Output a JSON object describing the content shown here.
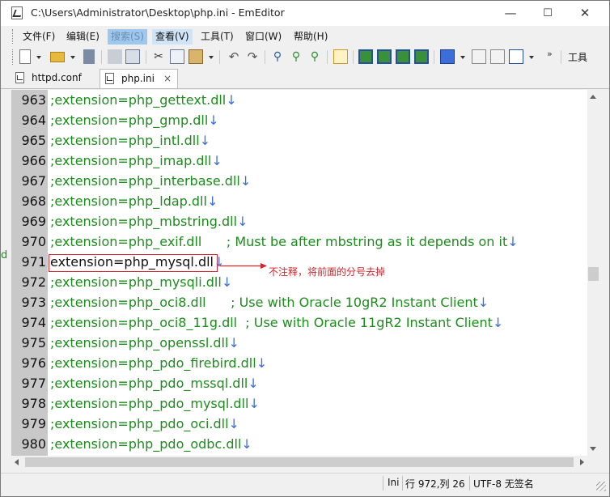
{
  "window": {
    "title": "C:\\Users\\Administrator\\Desktop\\php.ini - EmEditor",
    "controls": {
      "minimize": "—",
      "maximize": "☐",
      "close": "✕"
    }
  },
  "menu": [
    {
      "label": "文件(F)"
    },
    {
      "label": "编辑(E)"
    },
    {
      "label": "搜索(S)"
    },
    {
      "label": "查看(V)"
    },
    {
      "label": "工具(T)"
    },
    {
      "label": "窗口(W)"
    },
    {
      "label": "帮助(H)"
    }
  ],
  "toolbar": {
    "overflow": "»",
    "tools_label": "工具",
    "icons": [
      "new-file-icon",
      "open-folder-icon",
      "save-icon",
      "print-icon",
      "print-preview-icon",
      "cut-icon",
      "copy-icon",
      "paste-icon",
      "undo-icon",
      "redo-icon",
      "find-icon",
      "find-next-icon",
      "find-previous-icon",
      "highlight-icon",
      "toolbar-green-icon",
      "toolbar-refresh-icon",
      "toolbar-sync-icon",
      "toolbar-export-icon",
      "macro-icon",
      "record-macro-icon",
      "run-macro-icon",
      "window-icon"
    ]
  },
  "tabs": [
    {
      "label": "httpd.conf",
      "active": false
    },
    {
      "label": "php.ini",
      "active": true,
      "close": "×"
    }
  ],
  "editor": {
    "current_line": 971,
    "lines": [
      {
        "num": "963",
        "text": ";extension=php_gettext.dll"
      },
      {
        "num": "964",
        "text": ";extension=php_gmp.dll"
      },
      {
        "num": "965",
        "text": ";extension=php_intl.dll"
      },
      {
        "num": "966",
        "text": ";extension=php_imap.dll"
      },
      {
        "num": "967",
        "text": ";extension=php_interbase.dll"
      },
      {
        "num": "968",
        "text": ";extension=php_ldap.dll"
      },
      {
        "num": "969",
        "text": ";extension=php_mbstring.dll"
      },
      {
        "num": "970",
        "text": ";extension=php_exif.dll      ; Must be after mbstring as it depends on it"
      },
      {
        "num": "971",
        "text": "extension=php_mysql.dll"
      },
      {
        "num": "972",
        "text": ";extension=php_mysqli.dll"
      },
      {
        "num": "973",
        "text": ";extension=php_oci8.dll      ; Use with Oracle 10gR2 Instant Client"
      },
      {
        "num": "974",
        "text": ";extension=php_oci8_11g.dll  ; Use with Oracle 11gR2 Instant Client"
      },
      {
        "num": "975",
        "text": ";extension=php_openssl.dll"
      },
      {
        "num": "976",
        "text": ";extension=php_pdo_firebird.dll"
      },
      {
        "num": "977",
        "text": ";extension=php_pdo_mssql.dll"
      },
      {
        "num": "978",
        "text": ";extension=php_pdo_mysql.dll"
      },
      {
        "num": "979",
        "text": ";extension=php_pdo_oci.dll"
      },
      {
        "num": "980",
        "text": ";extension=php_pdo_odbc.dll"
      }
    ],
    "eol_mark": "↓",
    "annotation": "不注释，将前面的分号去掉"
  },
  "status": {
    "mode": "Ini",
    "position": "行 972,列 26",
    "encoding": "UTF-8 无签名"
  },
  "colors": {
    "comment": "#1c8c1c",
    "eol_mark": "#3b6ed8",
    "annotation": "#d2242a",
    "gutter": "#c8c8c8"
  }
}
